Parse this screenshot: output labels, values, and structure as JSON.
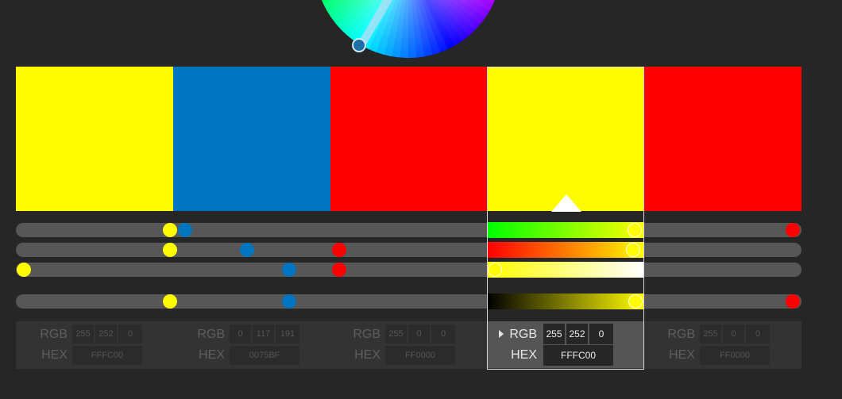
{
  "colors": {
    "background": "#262626",
    "track": "#575757",
    "yellow": "#FFFC00",
    "blue": "#0075BF",
    "red": "#FF0000"
  },
  "swatches": [
    {
      "hex": "#FFFC00"
    },
    {
      "hex": "#0075BF"
    },
    {
      "hex": "#FF0000"
    },
    {
      "hex": "#FFFC00",
      "active": true
    },
    {
      "hex": "#FF0000"
    }
  ],
  "color_panels": [
    {
      "rgb_label": "RGB",
      "hex_label": "HEX",
      "r": "255",
      "g": "252",
      "b": "0",
      "hex": "FFFC00"
    },
    {
      "rgb_label": "RGB",
      "hex_label": "HEX",
      "r": "0",
      "g": "117",
      "b": "191",
      "hex": "0075BF"
    },
    {
      "rgb_label": "RGB",
      "hex_label": "HEX",
      "r": "255",
      "g": "0",
      "b": "0",
      "hex": "FF0000"
    },
    {
      "rgb_label": "RGB",
      "hex_label": "HEX",
      "r": "255",
      "g": "252",
      "b": "0",
      "hex": "FFFC00"
    },
    {
      "rgb_label": "RGB",
      "hex_label": "HEX",
      "r": "255",
      "g": "0",
      "b": "0",
      "hex": "FF0000"
    }
  ],
  "sliders": {
    "hue": {
      "yellow": 0.19,
      "blue": 0.21,
      "red": 1.0
    },
    "saturation": {
      "yellow": 0.19,
      "blue": 0.29,
      "red": 0.41
    },
    "brightness": {
      "yellow": 0.0,
      "blue": 0.345,
      "red": 0.41
    },
    "value": {
      "yellow": 0.19,
      "blue": 0.345,
      "red": 1.0
    }
  },
  "icons": {
    "color_wheel": "color-wheel-icon",
    "expand_arrow": "triangle-right-icon",
    "selection_caret": "triangle-up-icon"
  }
}
